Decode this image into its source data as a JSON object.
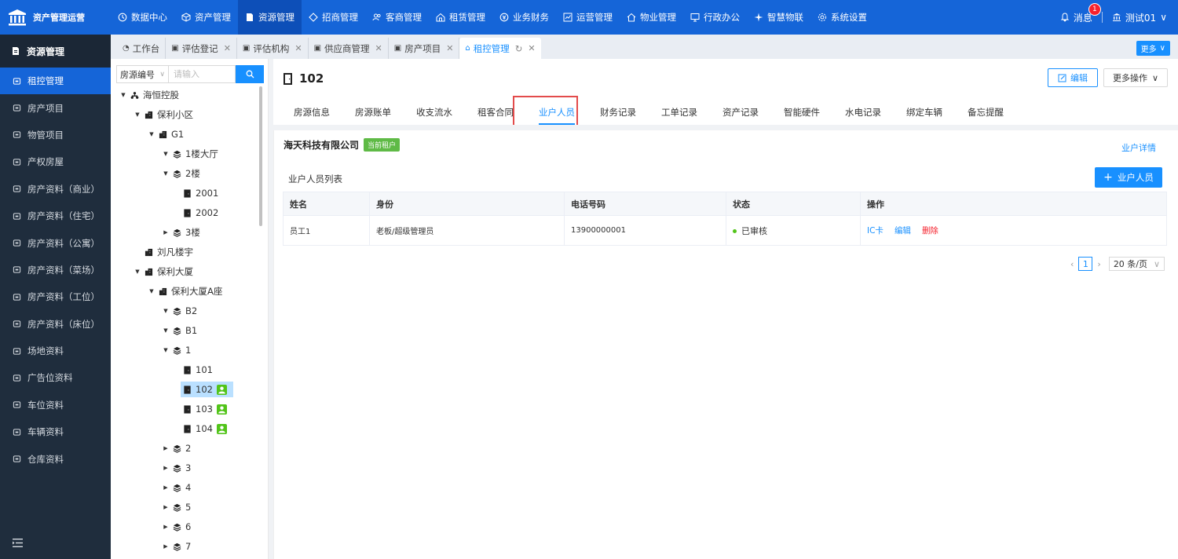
{
  "brand": {
    "title": "资产管理运营"
  },
  "nav": [
    {
      "label": "数据中心",
      "icon": "clock-icon"
    },
    {
      "label": "资产管理",
      "icon": "cube-icon"
    },
    {
      "label": "资源管理",
      "icon": "document-icon",
      "active": true
    },
    {
      "label": "招商管理",
      "icon": "diamond-icon"
    },
    {
      "label": "客商管理",
      "icon": "people-icon"
    },
    {
      "label": "租赁管理",
      "icon": "house-icon"
    },
    {
      "label": "业务财务",
      "icon": "coin-icon"
    },
    {
      "label": "运营管理",
      "icon": "chart-icon"
    },
    {
      "label": "物业管理",
      "icon": "home-icon"
    },
    {
      "label": "行政办公",
      "icon": "monitor-icon"
    },
    {
      "label": "智慧物联",
      "icon": "sparkle-icon"
    },
    {
      "label": "系统设置",
      "icon": "gear-icon"
    }
  ],
  "header": {
    "messages_label": "消息",
    "messages_count": "1",
    "user_label": "测试01"
  },
  "sidebar": {
    "title": "资源管理",
    "items": [
      {
        "label": "租控管理",
        "active": true
      },
      {
        "label": "房产项目"
      },
      {
        "label": "物管项目"
      },
      {
        "label": "产权房屋"
      },
      {
        "label": "房产资料（商业）"
      },
      {
        "label": "房产资料（住宅）"
      },
      {
        "label": "房产资料（公寓）"
      },
      {
        "label": "房产资料（菜场）"
      },
      {
        "label": "房产资料（工位）"
      },
      {
        "label": "房产资料（床位）"
      },
      {
        "label": "场地资料"
      },
      {
        "label": "广告位资料"
      },
      {
        "label": "车位资料"
      },
      {
        "label": "车辆资料"
      },
      {
        "label": "仓库资料"
      }
    ]
  },
  "tabs": [
    {
      "label": "工作台",
      "closable": false
    },
    {
      "label": "评估登记",
      "closable": true
    },
    {
      "label": "评估机构",
      "closable": true
    },
    {
      "label": "供应商管理",
      "closable": true
    },
    {
      "label": "房产项目",
      "closable": true
    },
    {
      "label": "租控管理",
      "closable": true,
      "active": true
    }
  ],
  "tabs_more_label": "更多",
  "tree_search": {
    "select_value": "房源编号",
    "placeholder": "请输入"
  },
  "tree": [
    {
      "label": "海恒控股",
      "level": 0,
      "caret": "down",
      "icon": "org-icon"
    },
    {
      "label": "保利小区",
      "level": 1,
      "caret": "down",
      "icon": "building-icon"
    },
    {
      "label": "G1",
      "level": 2,
      "caret": "down",
      "icon": "building-icon"
    },
    {
      "label": "1楼大厅",
      "level": 3,
      "caret": "down",
      "icon": "layers-icon"
    },
    {
      "label": "2楼",
      "level": 3,
      "caret": "down",
      "icon": "layers-icon"
    },
    {
      "label": "2001",
      "level": 4,
      "caret": "",
      "icon": "room-icon"
    },
    {
      "label": "2002",
      "level": 4,
      "caret": "",
      "icon": "room-icon"
    },
    {
      "label": "3楼",
      "level": 3,
      "caret": "right",
      "icon": "layers-icon"
    },
    {
      "label": "刘凡楼宇",
      "level": 1,
      "caret": "",
      "icon": "building-icon"
    },
    {
      "label": "保利大厦",
      "level": 1,
      "caret": "down",
      "icon": "building-icon"
    },
    {
      "label": "保利大厦A座",
      "level": 2,
      "caret": "down",
      "icon": "building-icon"
    },
    {
      "label": "B2",
      "level": 3,
      "caret": "down",
      "icon": "layers-icon"
    },
    {
      "label": "B1",
      "level": 3,
      "caret": "down",
      "icon": "layers-icon"
    },
    {
      "label": "1",
      "level": 3,
      "caret": "down",
      "icon": "layers-icon"
    },
    {
      "label": "101",
      "level": 4,
      "caret": "",
      "icon": "room-icon"
    },
    {
      "label": "102",
      "level": 4,
      "caret": "",
      "icon": "room-icon",
      "tenant": true,
      "selected": true
    },
    {
      "label": "103",
      "level": 4,
      "caret": "",
      "icon": "room-icon",
      "tenant": true
    },
    {
      "label": "104",
      "level": 4,
      "caret": "",
      "icon": "room-icon",
      "tenant": true
    },
    {
      "label": "2",
      "level": 3,
      "caret": "right",
      "icon": "layers-icon"
    },
    {
      "label": "3",
      "level": 3,
      "caret": "right",
      "icon": "layers-icon"
    },
    {
      "label": "4",
      "level": 3,
      "caret": "right",
      "icon": "layers-icon"
    },
    {
      "label": "5",
      "level": 3,
      "caret": "right",
      "icon": "layers-icon"
    },
    {
      "label": "6",
      "level": 3,
      "caret": "right",
      "icon": "layers-icon"
    },
    {
      "label": "7",
      "level": 3,
      "caret": "right",
      "icon": "layers-icon"
    }
  ],
  "main": {
    "room_title": "102",
    "edit_label": "编辑",
    "more_label": "更多操作",
    "subtabs": [
      {
        "label": "房源信息"
      },
      {
        "label": "房源账单"
      },
      {
        "label": "收支流水"
      },
      {
        "label": "租客合同"
      },
      {
        "label": "业户人员",
        "active": true
      },
      {
        "label": "财务记录"
      },
      {
        "label": "工单记录"
      },
      {
        "label": "资产记录"
      },
      {
        "label": "智能硬件"
      },
      {
        "label": "水电记录"
      },
      {
        "label": "绑定车辆"
      },
      {
        "label": "备忘提醒"
      }
    ],
    "tenant_name": "海天科技有限公司",
    "tenant_tag": "当前租户",
    "detail_link": "业户详情",
    "list_title": "业户人员列表",
    "add_label": "业户人员",
    "table": {
      "columns": [
        "姓名",
        "身份",
        "电话号码",
        "状态",
        "操作"
      ],
      "rows": [
        {
          "name": "员工1",
          "role": "老板/超级管理员",
          "phone": "13900000001",
          "status": "已审核",
          "actions": [
            "IC卡",
            "编辑",
            "删除"
          ]
        }
      ]
    },
    "pager": {
      "current": "1",
      "page_size": "20 条/页"
    }
  },
  "colors": {
    "primary": "#1890ff",
    "topbar": "#1565d8",
    "sidebar": "#1f2d3d",
    "tag_green": "#5fba46",
    "danger": "#f5222d"
  }
}
